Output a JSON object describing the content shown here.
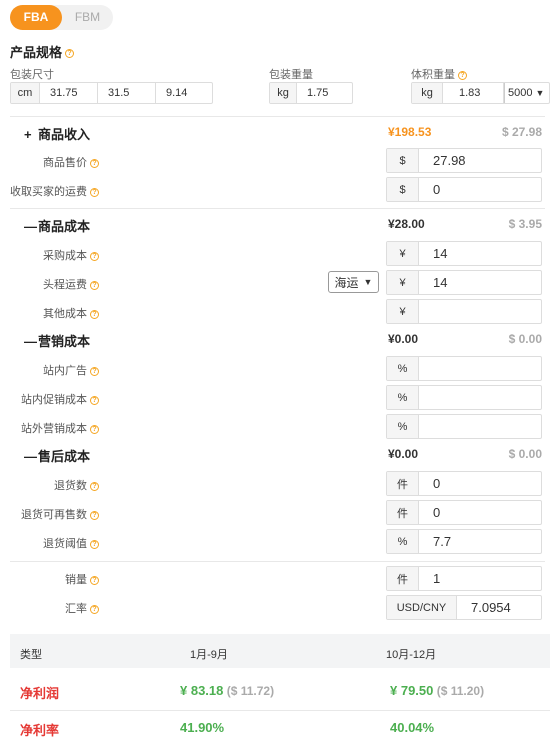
{
  "tabs": {
    "active": "FBA",
    "inactive": "FBM"
  },
  "spec": {
    "title": "产品规格",
    "pkg_size_label": "包装尺寸",
    "pkg_size_unit": "cm",
    "length": "31.75",
    "width": "31.5",
    "height": "9.14",
    "pkg_weight_label": "包装重量",
    "pkg_weight_unit": "kg",
    "pkg_weight": "1.75",
    "vol_weight_label": "体积重量",
    "vol_weight_unit": "kg",
    "vol_weight": "1.83",
    "vol_divisor": "5000"
  },
  "income": {
    "sign": "+",
    "title": "商品收入",
    "cny": "¥198.53",
    "usd": "$ 27.98",
    "price_label": "商品售价",
    "price_unit": "$",
    "price": "27.98",
    "shipping_label": "收取买家的运费",
    "shipping_unit": "$",
    "shipping": "0"
  },
  "goods_cost": {
    "sign": "—",
    "title": "商品成本",
    "cny": "¥28.00",
    "usd": "$ 3.95",
    "purchase_label": "采购成本",
    "purchase_unit": "¥",
    "purchase": "14",
    "freight_label": "头程运费",
    "freight_mode": "海运",
    "freight_unit": "¥",
    "freight": "14",
    "other_label": "其他成本",
    "other_unit": "¥",
    "other": ""
  },
  "marketing": {
    "sign": "—",
    "title": "营销成本",
    "cny": "¥0.00",
    "usd": "$ 0.00",
    "ads_label": "站内广告",
    "ads_unit": "%",
    "ads": "",
    "promo_label": "站内促销成本",
    "promo_unit": "%",
    "promo": "",
    "offsite_label": "站外营销成本",
    "offsite_unit": "%",
    "offsite": ""
  },
  "aftersale": {
    "sign": "—",
    "title": "售后成本",
    "cny": "¥0.00",
    "usd": "$ 0.00",
    "returns_label": "退货数",
    "returns_unit": "件",
    "returns": "0",
    "resell_label": "退货可再售数",
    "resell_unit": "件",
    "resell": "0",
    "threshold_label": "退货阈值",
    "threshold_unit": "%",
    "threshold": "7.7"
  },
  "sales": {
    "qty_label": "销量",
    "qty_unit": "件",
    "qty": "1",
    "fx_label": "汇率",
    "fx_unit": "USD/CNY",
    "fx": "7.0954"
  },
  "summary": {
    "col_type": "类型",
    "col_1": "1月-9月",
    "col_2": "10月-12月",
    "profit_label": "净利润",
    "profit_1_cny": "¥ 83.18",
    "profit_1_usd": "($ 11.72)",
    "profit_2_cny": "¥ 79.50",
    "profit_2_usd": "($ 11.20)",
    "margin_label": "净利率",
    "margin_1": "41.90%",
    "margin_2": "40.04%"
  }
}
